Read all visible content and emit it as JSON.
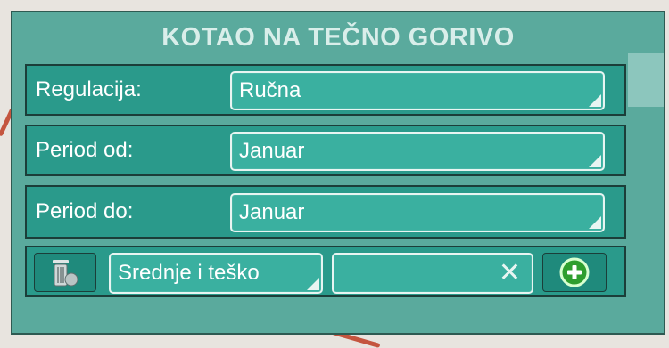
{
  "panel": {
    "title": "KOTAO NA TEČNO GORIVO",
    "rows": [
      {
        "label": "Regulacija:",
        "value": "Ručna"
      },
      {
        "label": "Period od:",
        "value": "Januar"
      },
      {
        "label": "Period do:",
        "value": "Januar"
      }
    ],
    "toolbar": {
      "delete_icon": "trash-icon",
      "category_value": "Srednje i teško",
      "search_value": "",
      "clear_icon": "close-icon",
      "add_icon": "plus-circle-icon"
    }
  },
  "colors": {
    "panel_bg": "#5aaa9d",
    "row_bg": "#2a9a8b",
    "field_bg": "#3ab0a0",
    "add_button": "#2e9e2e"
  }
}
